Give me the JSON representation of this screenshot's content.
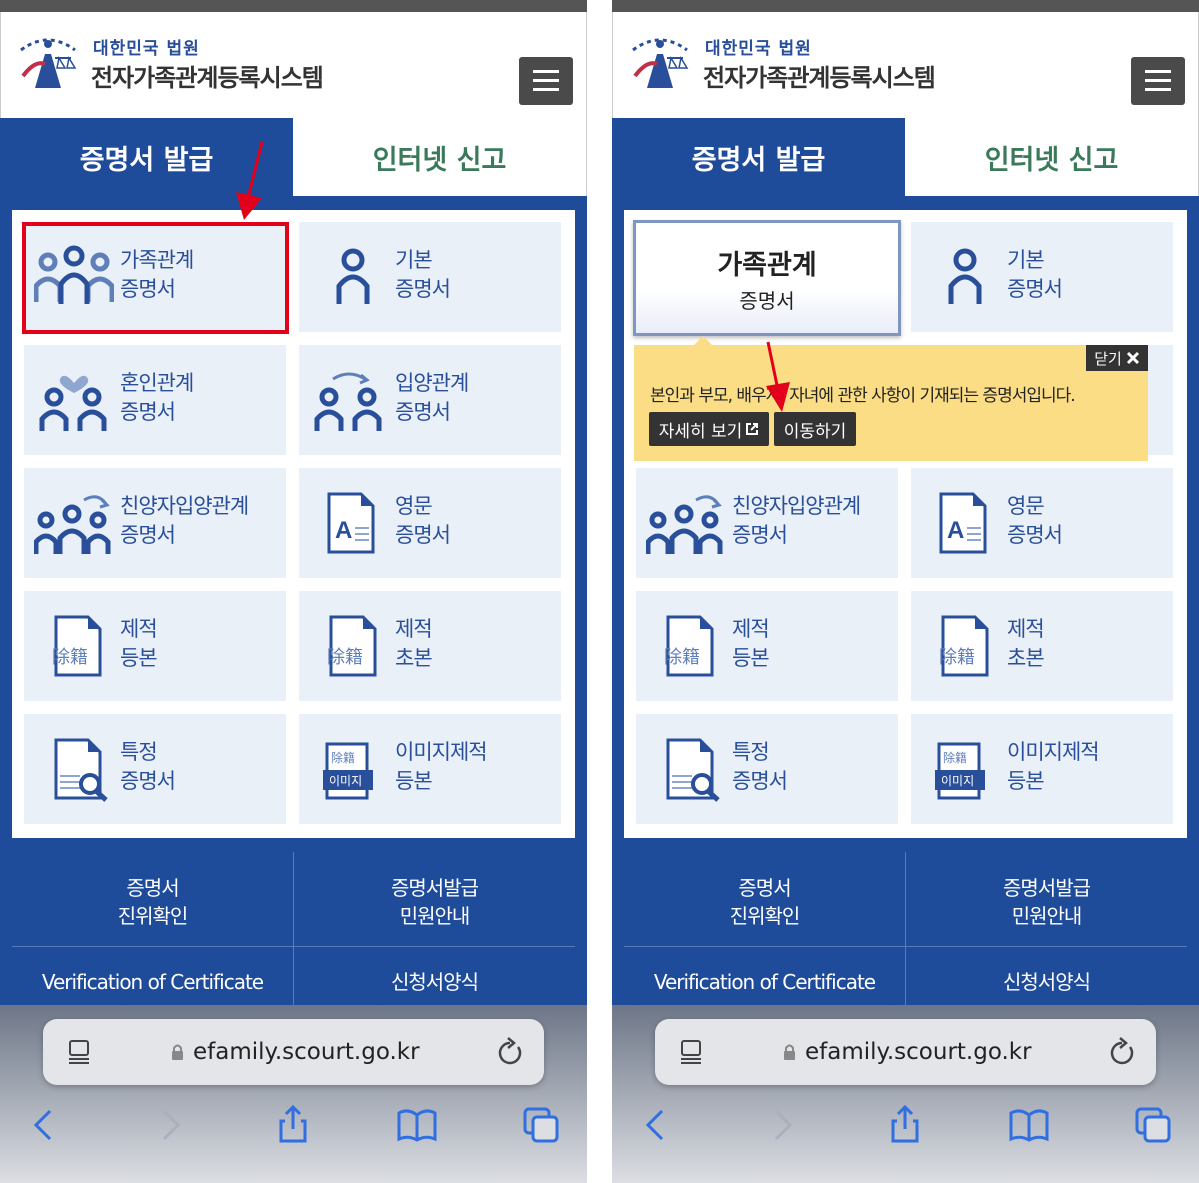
{
  "header": {
    "court_name": "대한민국 법원",
    "system_name": "전자가족관계등록시스템"
  },
  "tabs": {
    "active": "증명서 발급",
    "inactive": "인터넷 신고"
  },
  "cards": [
    {
      "line1": "가족관계",
      "line2": "증명서",
      "icon": "family-icon"
    },
    {
      "line1": "기본",
      "line2": "증명서",
      "icon": "person-icon"
    },
    {
      "line1": "혼인관계",
      "line2": "증명서",
      "icon": "marriage-icon"
    },
    {
      "line1": "입양관계",
      "line2": "증명서",
      "icon": "adoption-icon"
    },
    {
      "line1": "친양자입양관계",
      "line2": "증명서",
      "icon": "family-adoption-icon"
    },
    {
      "line1": "영문",
      "line2": "증명서",
      "icon": "english-doc-icon"
    },
    {
      "line1": "제적",
      "line2": "등본",
      "icon": "removed-register-icon"
    },
    {
      "line1": "제적",
      "line2": "초본",
      "icon": "removed-register-icon"
    },
    {
      "line1": "특정",
      "line2": "증명서",
      "icon": "search-doc-icon"
    },
    {
      "line1": "이미지제적",
      "line2": "등본",
      "icon": "image-register-icon"
    }
  ],
  "icon_text": {
    "removed": "除籍",
    "image_top": "除籍",
    "image_label": "이미지",
    "english_letter": "A"
  },
  "tooltip": {
    "close_label": "닫기",
    "description": "본인과 부모, 배우자, 자녀에 관한 사항이 기재되는 증명서입니다.",
    "details_button": "자세히 보기",
    "go_button": "이동하기"
  },
  "bottom_links": {
    "verify": [
      "증명서",
      "진위확인"
    ],
    "guide": [
      "증명서발급",
      "민원안내"
    ],
    "verification_en": "Verification of Certificate",
    "forms": "신청서양식"
  },
  "browser": {
    "url": "efamily.scourt.go.kr"
  },
  "colors": {
    "brand_blue": "#1f4c9a",
    "card_bg": "#eaf0f8",
    "tab_green": "#3a7a5a",
    "highlight_red": "#e3001b",
    "tooltip_yellow": "#fadd84"
  }
}
